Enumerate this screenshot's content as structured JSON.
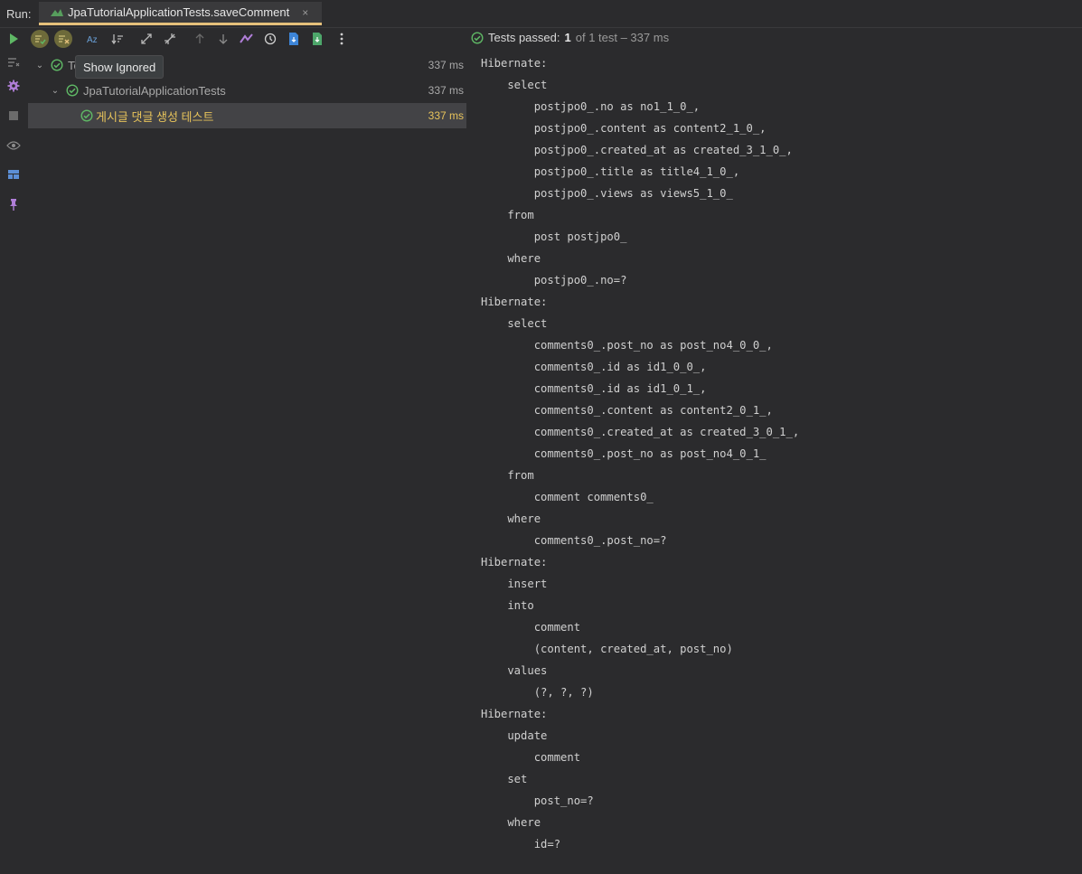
{
  "run_label": "Run:",
  "tab": {
    "title": "JpaTutorialApplicationTests.saveComment",
    "close": "×"
  },
  "toolbar": {
    "buttons": [
      {
        "icon": "run-icon"
      },
      {
        "icon": "show-passed-icon"
      },
      {
        "icon": "show-ignored-icon"
      },
      {
        "icon": "sort-alphabetically-icon"
      },
      {
        "icon": "sort-by-duration-icon"
      },
      {
        "icon": "expand-all-icon"
      },
      {
        "icon": "collapse-all-icon"
      },
      {
        "icon": "previous-failed-icon"
      },
      {
        "icon": "next-failed-icon"
      },
      {
        "icon": "import-tests-icon"
      },
      {
        "icon": "history-icon"
      },
      {
        "icon": "export-icon"
      },
      {
        "icon": "export-results-icon"
      },
      {
        "icon": "more-options-icon"
      }
    ]
  },
  "tooltip": "Show Ignored",
  "status": {
    "prefix": "Tests passed: ",
    "count": "1",
    "rest": "of 1 test – 337 ms"
  },
  "tree": [
    {
      "label": "Te",
      "time": "337 ms",
      "level": 0
    },
    {
      "label": "JpaTutorialApplicationTests",
      "time": "337 ms",
      "level": 1
    },
    {
      "label": "게시글 댓글 생성 테스트",
      "time": "337 ms",
      "level": 2
    }
  ],
  "console": [
    "Hibernate: ",
    "    select",
    "        postjpo0_.no as no1_1_0_,",
    "        postjpo0_.content as content2_1_0_,",
    "        postjpo0_.created_at as created_3_1_0_,",
    "        postjpo0_.title as title4_1_0_,",
    "        postjpo0_.views as views5_1_0_ ",
    "    from",
    "        post postjpo0_ ",
    "    where",
    "        postjpo0_.no=?",
    "Hibernate: ",
    "    select",
    "        comments0_.post_no as post_no4_0_0_,",
    "        comments0_.id as id1_0_0_,",
    "        comments0_.id as id1_0_1_,",
    "        comments0_.content as content2_0_1_,",
    "        comments0_.created_at as created_3_0_1_,",
    "        comments0_.post_no as post_no4_0_1_ ",
    "    from",
    "        comment comments0_ ",
    "    where",
    "        comments0_.post_no=?",
    "Hibernate: ",
    "    insert ",
    "    into",
    "        comment",
    "        (content, created_at, post_no) ",
    "    values",
    "        (?, ?, ?)",
    "Hibernate: ",
    "    update",
    "        comment ",
    "    set",
    "        post_no=? ",
    "    where",
    "        id=?"
  ],
  "colors": {
    "accent": "#e5c07b",
    "pass": "#5fb865",
    "selected_text": "#e7c35b"
  }
}
